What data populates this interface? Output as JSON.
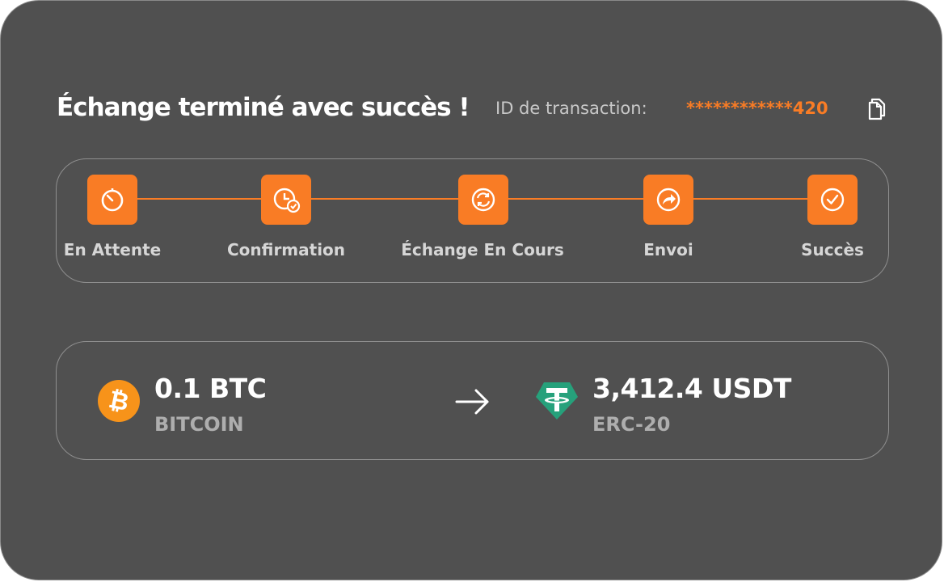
{
  "header": {
    "title": "Échange terminé avec succès !",
    "transaction_label": "ID de transaction:",
    "transaction_id": "************420",
    "copy_icon": "copy-icon"
  },
  "steps": [
    {
      "label": "En Attente",
      "icon": "timer-icon"
    },
    {
      "label": "Confirmation",
      "icon": "clock-check-icon"
    },
    {
      "label": "Échange En Cours",
      "icon": "refresh-icon"
    },
    {
      "label": "Envoi",
      "icon": "share-arrow-icon"
    },
    {
      "label": "Succès",
      "icon": "check-circle-icon"
    }
  ],
  "swap": {
    "from": {
      "amount": "0.1 BTC",
      "network": "BITCOIN",
      "icon": "bitcoin-icon"
    },
    "to": {
      "amount": "3,412.4 USDT",
      "network": "ERC-20",
      "icon": "tether-icon"
    },
    "arrow_icon": "arrow-right-icon"
  },
  "colors": {
    "background": "#505050",
    "accent": "#f97c25",
    "bitcoin": "#f7931a",
    "tether": "#26a17b"
  }
}
